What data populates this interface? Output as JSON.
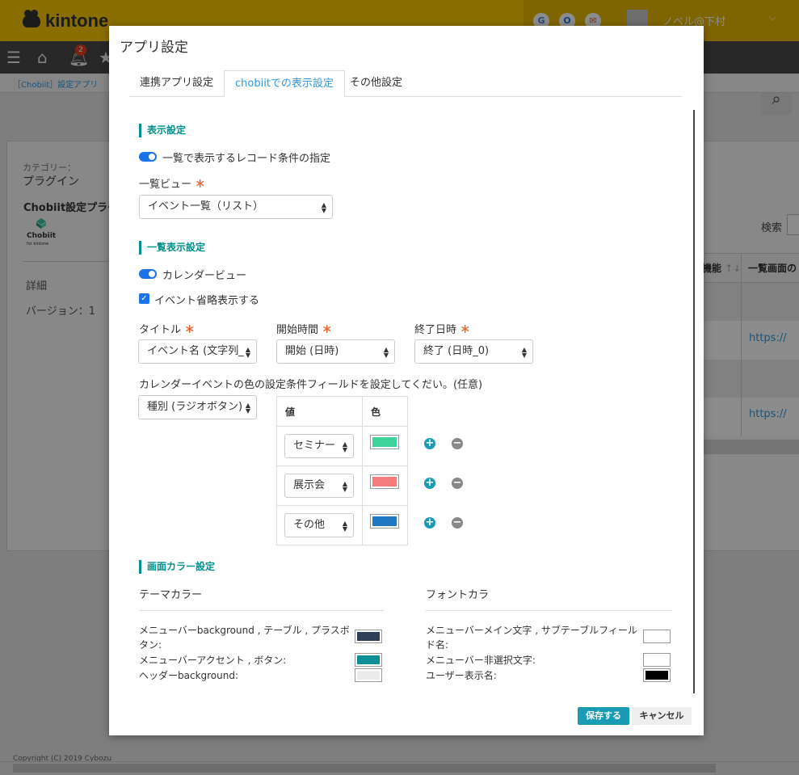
{
  "background": {
    "logo": "kintone",
    "user_name": "ノベル@下村",
    "notification_count": "2",
    "breadcrumb": "［Chobiit］設定アプリ",
    "category_label": "カテゴリー：",
    "category_value": "プラグイン",
    "plugin_name": "Chobiit設定プラグ",
    "plugin_logo_text": "Chobiit",
    "plugin_logo_sub": "for kintone",
    "details_label": "詳細",
    "version_label": "バージョン：1",
    "search_label": "検索",
    "table_headers": [
      "機能",
      "一覧画面の"
    ],
    "links": [
      "https://",
      "https://"
    ],
    "footer": "Copyright (C) 2019 Cybozu"
  },
  "modal": {
    "title": "アプリ設定",
    "tabs": [
      "連携アプリ設定",
      "chobiitでの表示設定",
      "その他設定"
    ],
    "active_tab": "chobiitでの表示設定",
    "display_settings": {
      "title": "表示設定",
      "toggle_label": "一覧で表示するレコード条件の指定",
      "view_label": "一覧ビュー",
      "view_value": "イベント一覧（リスト）"
    },
    "list_settings": {
      "title": "一覧表示設定",
      "calendar_toggle": "カレンダービュー",
      "event_short_checkbox": "イベント省略表示する",
      "title_label": "タイトル",
      "title_value": "イベント名 (文字列_",
      "start_label": "開始時間",
      "start_value": "開始 (日時)",
      "end_label": "終了日時",
      "end_value": "終了 (日時_0)",
      "color_condition_label": "カレンダーイベントの色の設定条件フィールドを設定してくだい。(任意)",
      "color_field_value": "種別 (ラジオボタン)",
      "color_table": {
        "headers": [
          "値",
          "色"
        ],
        "rows": [
          {
            "value": "セミナー",
            "color": "#3dd39a"
          },
          {
            "value": "展示会",
            "color": "#f47c7c"
          },
          {
            "value": "その他",
            "color": "#1f78c1"
          }
        ]
      }
    },
    "screen_color": {
      "title": "画面カラー設定",
      "theme_header": "テーマカラー",
      "font_header": "フォントカラ",
      "theme_rows": [
        {
          "label": "メニューバーbackground , テーブル , プラスボタン:",
          "color": "#2e4057"
        },
        {
          "label": "メニューバーアクセント , ボタン:",
          "color": "#0e8f95"
        },
        {
          "label": "ヘッダーbackground:",
          "color": "#ececec"
        }
      ],
      "font_rows": [
        {
          "label": "メニューバーメイン文字 , サブテーブルフィールド名:",
          "color": "#ffffff"
        },
        {
          "label": "メニューバー非選択文字:",
          "color": "#ffffff"
        },
        {
          "label": "ユーザー表示名:",
          "color": "#000000"
        }
      ]
    },
    "buttons": {
      "save": "保存する",
      "cancel": "キャンセル"
    }
  },
  "colors": {
    "accent": "#00918c",
    "link": "#3498db",
    "save_button": "#1a9bb5",
    "toggle": "#1a73e8"
  }
}
